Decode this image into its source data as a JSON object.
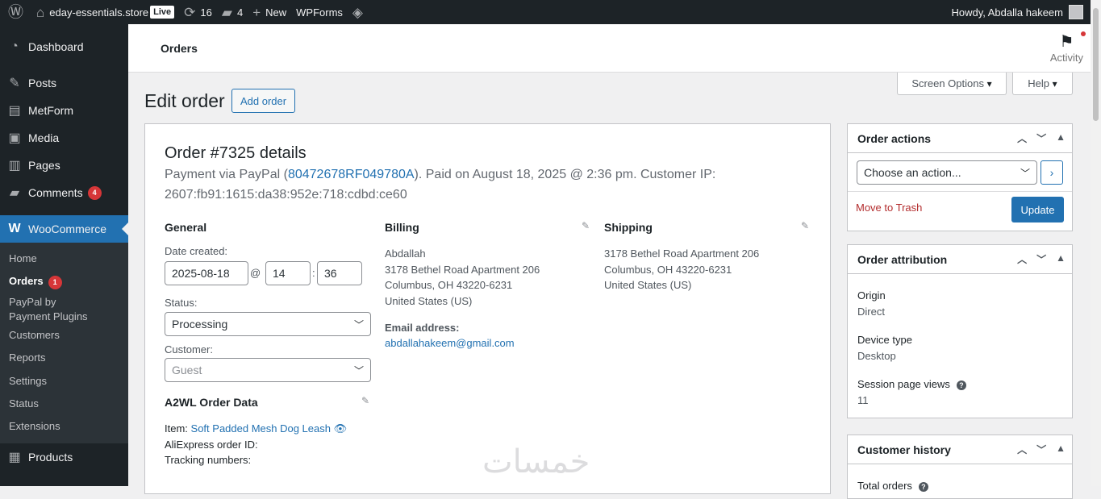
{
  "admin_bar": {
    "site_name": "eday-essentials.store",
    "live_badge": "Live",
    "updates_count": "16",
    "comments_count": "4",
    "new_label": "New",
    "wpforms_label": "WPForms",
    "howdy": "Howdy, Abdalla hakeem"
  },
  "sidebar": {
    "items": [
      {
        "label": "Dashboard",
        "icon": "dashboard-icon"
      },
      {
        "label": "Posts",
        "icon": "pin-icon"
      },
      {
        "label": "MetForm",
        "icon": "form-icon"
      },
      {
        "label": "Media",
        "icon": "media-icon"
      },
      {
        "label": "Pages",
        "icon": "pages-icon"
      },
      {
        "label": "Comments",
        "icon": "comment-icon",
        "badge": "4"
      },
      {
        "label": "WooCommerce",
        "icon": "woo-icon"
      },
      {
        "label": "Products",
        "icon": "products-icon"
      }
    ],
    "woo_sub": [
      {
        "label": "Home"
      },
      {
        "label": "Orders",
        "badge": "1"
      },
      {
        "label": "PayPal by",
        "label2": "Payment Plugins"
      },
      {
        "label": "Customers"
      },
      {
        "label": "Reports"
      },
      {
        "label": "Settings"
      },
      {
        "label": "Status"
      },
      {
        "label": "Extensions"
      }
    ]
  },
  "topbar": {
    "title": "Orders",
    "activity_label": "Activity"
  },
  "screen_options_label": "Screen Options",
  "help_label": "Help",
  "page_title": "Edit order",
  "add_order_label": "Add order",
  "order": {
    "title": "Order #7325 details",
    "payment_prefix": "Payment via PayPal (",
    "transaction_id": "80472678RF049780A",
    "payment_suffix": "). Paid on August 18, 2025 @ 2:36 pm. Customer IP: 2607:fb91:1615:da38:952e:718:cdbd:ce60"
  },
  "general": {
    "heading": "General",
    "date_label": "Date created:",
    "date": "2025-08-18",
    "at": "@",
    "hour": "14",
    "colon": ":",
    "minute": "36",
    "status_label": "Status:",
    "status_value": "Processing",
    "customer_label": "Customer:",
    "customer_placeholder": "Guest"
  },
  "billing": {
    "heading": "Billing",
    "name": "Abdallah",
    "line1": "3178 Bethel Road Apartment 206",
    "line2": "Columbus, OH 43220-6231",
    "country": "United States (US)",
    "email_label": "Email address:",
    "email": "abdallahakeem@gmail.com"
  },
  "shipping": {
    "heading": "Shipping",
    "line1": "3178 Bethel Road Apartment 206",
    "line2": "Columbus, OH 43220-6231",
    "country": "United States (US)"
  },
  "a2wl": {
    "heading": "A2WL Order Data",
    "item_label": "Item:",
    "item_link": "Soft Padded Mesh Dog Leash",
    "aliexpress_label": "AliExpress order ID:",
    "tracking_label": "Tracking numbers:"
  },
  "order_actions": {
    "title": "Order actions",
    "choose": "Choose an action...",
    "trash": "Move to Trash",
    "update": "Update"
  },
  "attribution": {
    "title": "Order attribution",
    "origin_label": "Origin",
    "origin": "Direct",
    "device_label": "Device type",
    "device": "Desktop",
    "views_label": "Session page views",
    "views": "11"
  },
  "customer_history": {
    "title": "Customer history",
    "total_orders_label": "Total orders"
  },
  "watermark": "خمسات",
  "colors": {
    "admin_bar": "#1d2327",
    "accent": "#2271b1",
    "badge": "#d63638"
  }
}
